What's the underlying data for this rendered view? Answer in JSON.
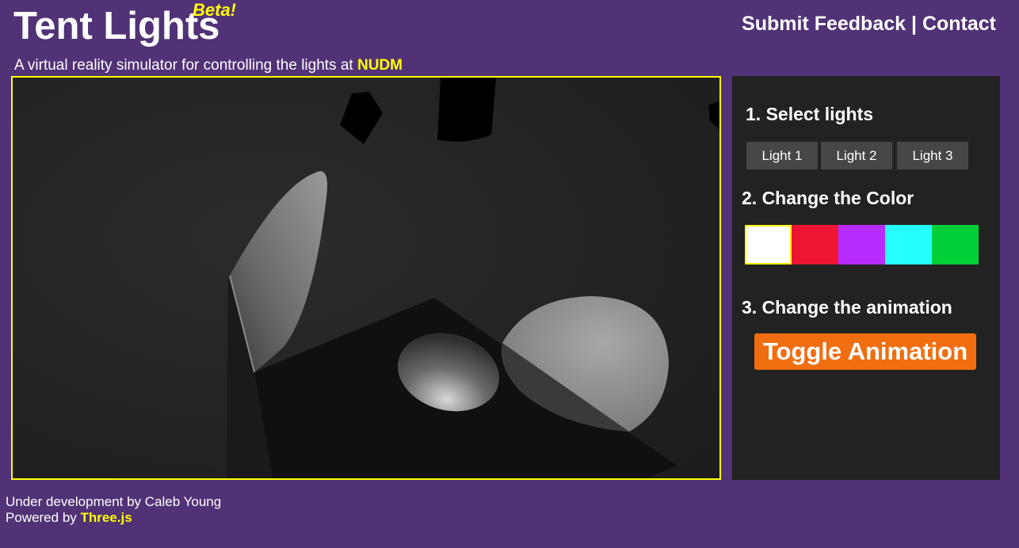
{
  "header": {
    "title": "Tent Lights",
    "beta_badge": "Beta!",
    "submit_feedback_link": "Submit Feedback",
    "separator": "|",
    "contact_link": "Contact",
    "subtitle_prefix": "A virtual reality simulator for controlling the lights at",
    "subtitle_highlight": "NUDM"
  },
  "controls": {
    "step1_label": "1. Select lights",
    "light_buttons": [
      "Light 1",
      "Light 2",
      "Light 3"
    ],
    "step2_label": "2. Change the Color",
    "colors": [
      "#ffffff",
      "#ee1533",
      "#b62cff",
      "#26ffff",
      "#00cf38"
    ],
    "selected_color": "#ffffff",
    "step3_label": "3. Change the animation",
    "toggle_label": "Toggle Animation"
  },
  "footer": {
    "credit": "Under development by Caleb Young",
    "powered_prefix": "Powered by",
    "powered_link": "Three.js"
  },
  "theme": {
    "background": "#513276",
    "highlight": "#ffff00",
    "panel": "#222222",
    "toggle_button": "#f06e10"
  }
}
